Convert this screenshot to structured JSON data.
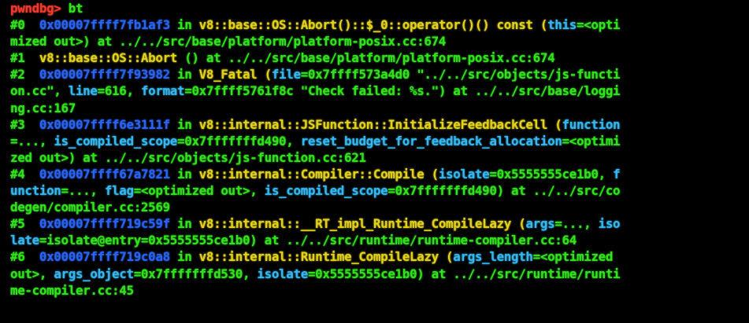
{
  "terminal": {
    "colors": {
      "background": "#000000",
      "prompt": "#f03a2e",
      "frame_number": "#34e11e",
      "address": "#2b63f2",
      "function": "#e3d21b",
      "keyword": "#34e11e",
      "argument": "#37b7ee",
      "path": "#34e11e"
    },
    "rows": [
      [
        {
          "t": "pwndbg> ",
          "c": "red"
        },
        {
          "t": "bt",
          "c": "green"
        }
      ],
      [
        {
          "t": "#0  ",
          "c": "green"
        },
        {
          "t": "0x00007ffff7fb1af3",
          "c": "blue"
        },
        {
          "t": " in ",
          "c": "green"
        },
        {
          "t": "v8::base::OS::Abort()::$_0::operator()() const",
          "c": "yellow"
        },
        {
          "t": " (",
          "c": "yellow"
        },
        {
          "t": "this",
          "c": "cyan"
        },
        {
          "t": "=<opti",
          "c": "green"
        }
      ],
      [
        {
          "t": "mized out>) at ../../src/base/platform/platform-posix.cc:674",
          "c": "green"
        }
      ],
      [
        {
          "t": "#1  ",
          "c": "green"
        },
        {
          "t": "v8::base::OS::Abort",
          "c": "yellow"
        },
        {
          "t": " () at ../../src/base/platform/platform-posix.cc:674",
          "c": "green"
        }
      ],
      [
        {
          "t": "#2  ",
          "c": "green"
        },
        {
          "t": "0x00007ffff7f93982",
          "c": "blue"
        },
        {
          "t": " in ",
          "c": "green"
        },
        {
          "t": "V8_Fatal",
          "c": "yellow"
        },
        {
          "t": " (",
          "c": "yellow"
        },
        {
          "t": "file",
          "c": "cyan"
        },
        {
          "t": "=0x7ffff573a4d0 \"../../src/objects/js-functi",
          "c": "green"
        }
      ],
      [
        {
          "t": "on.cc\", ",
          "c": "green"
        },
        {
          "t": "line",
          "c": "cyan"
        },
        {
          "t": "=616, ",
          "c": "green"
        },
        {
          "t": "format",
          "c": "cyan"
        },
        {
          "t": "=0x7ffff5761f8c \"Check failed: %s.\") at ../../src/base/loggi",
          "c": "green"
        }
      ],
      [
        {
          "t": "ng.cc:167",
          "c": "green"
        }
      ],
      [
        {
          "t": "#3  ",
          "c": "green"
        },
        {
          "t": "0x00007ffff6e3111f",
          "c": "blue"
        },
        {
          "t": " in ",
          "c": "green"
        },
        {
          "t": "v8::internal::JSFunction::InitializeFeedbackCell",
          "c": "yellow"
        },
        {
          "t": " (",
          "c": "yellow"
        },
        {
          "t": "function",
          "c": "cyan"
        }
      ],
      [
        {
          "t": "=..., ",
          "c": "green"
        },
        {
          "t": "is_compiled_scope",
          "c": "cyan"
        },
        {
          "t": "=0x7fffffffd490, ",
          "c": "green"
        },
        {
          "t": "reset_budget_for_feedback_allocation",
          "c": "cyan"
        },
        {
          "t": "=<optimi",
          "c": "green"
        }
      ],
      [
        {
          "t": "zed out>) at ../../src/objects/js-function.cc:621",
          "c": "green"
        }
      ],
      [
        {
          "t": "#4  ",
          "c": "green"
        },
        {
          "t": "0x00007ffff67a7821",
          "c": "blue"
        },
        {
          "t": " in ",
          "c": "green"
        },
        {
          "t": "v8::internal::Compiler::Compile",
          "c": "yellow"
        },
        {
          "t": " (",
          "c": "yellow"
        },
        {
          "t": "isolate",
          "c": "cyan"
        },
        {
          "t": "=0x5555555ce1b0, ",
          "c": "green"
        },
        {
          "t": "f",
          "c": "cyan"
        }
      ],
      [
        {
          "t": "unction",
          "c": "cyan"
        },
        {
          "t": "=..., ",
          "c": "green"
        },
        {
          "t": "flag",
          "c": "cyan"
        },
        {
          "t": "=<optimized out>, ",
          "c": "green"
        },
        {
          "t": "is_compiled_scope",
          "c": "cyan"
        },
        {
          "t": "=0x7fffffffd490) at ../../src/co",
          "c": "green"
        }
      ],
      [
        {
          "t": "degen/compiler.cc:2569",
          "c": "green"
        }
      ],
      [
        {
          "t": "#5  ",
          "c": "green"
        },
        {
          "t": "0x00007ffff719c59f",
          "c": "blue"
        },
        {
          "t": " in ",
          "c": "green"
        },
        {
          "t": "v8::internal::__RT_impl_Runtime_CompileLazy",
          "c": "yellow"
        },
        {
          "t": " (",
          "c": "yellow"
        },
        {
          "t": "args",
          "c": "cyan"
        },
        {
          "t": "=..., ",
          "c": "green"
        },
        {
          "t": "iso",
          "c": "cyan"
        }
      ],
      [
        {
          "t": "late",
          "c": "cyan"
        },
        {
          "t": "=isolate@entry=0x5555555ce1b0) at ../../src/runtime/runtime-compiler.cc:64",
          "c": "green"
        }
      ],
      [
        {
          "t": "#6  ",
          "c": "green"
        },
        {
          "t": "0x00007ffff719c0a8",
          "c": "blue"
        },
        {
          "t": " in ",
          "c": "green"
        },
        {
          "t": "v8::internal::Runtime_CompileLazy",
          "c": "yellow"
        },
        {
          "t": " (",
          "c": "yellow"
        },
        {
          "t": "args_length",
          "c": "cyan"
        },
        {
          "t": "=<optimized",
          "c": "green"
        }
      ],
      [
        {
          "t": "out>, ",
          "c": "green"
        },
        {
          "t": "args_object",
          "c": "cyan"
        },
        {
          "t": "=0x7fffffffd530, ",
          "c": "green"
        },
        {
          "t": "isolate",
          "c": "cyan"
        },
        {
          "t": "=0x5555555ce1b0) at ../../src/runtime/runti",
          "c": "green"
        }
      ],
      [
        {
          "t": "me-compiler.cc:45",
          "c": "green"
        }
      ]
    ]
  }
}
